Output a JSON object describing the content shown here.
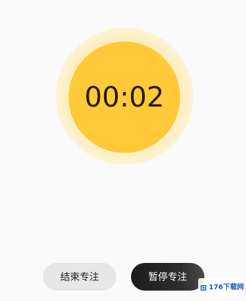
{
  "timer": {
    "display": "00:02",
    "ring_color": "#ffc93a",
    "text_color": "#2a1a10"
  },
  "actions": {
    "end_label": "结束专注",
    "pause_label": "暂停专注"
  },
  "watermark": {
    "text": "176下载网"
  }
}
